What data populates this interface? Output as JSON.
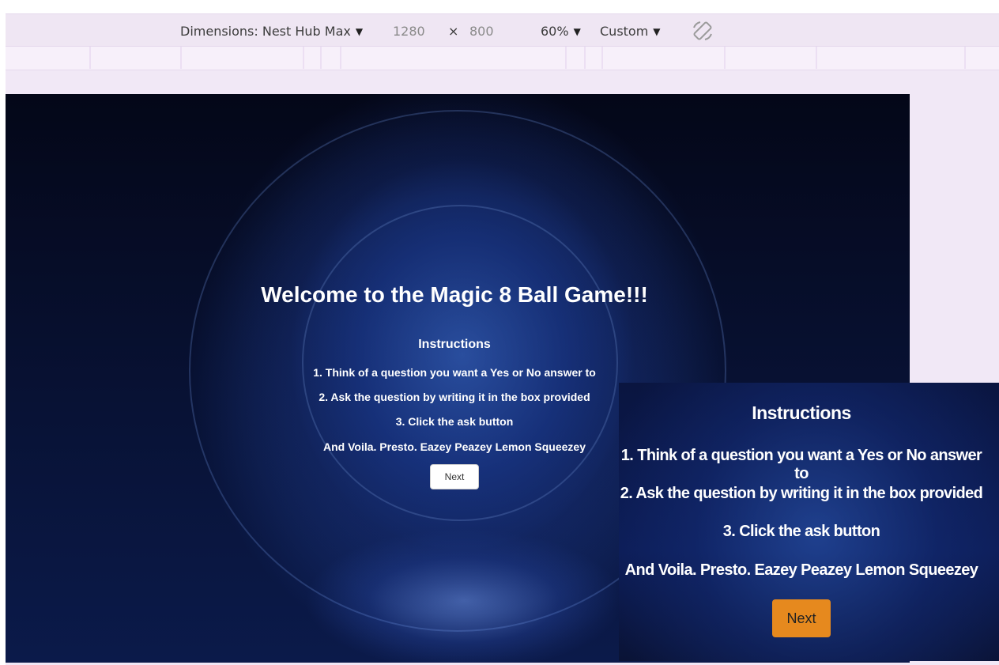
{
  "toolbar": {
    "dimensions_label": "Dimensions: Nest Hub Max",
    "width": "1280",
    "times": "×",
    "height": "800",
    "zoom": "60%",
    "throttle": "Custom",
    "caret": "▼",
    "rotate_icon": "rotate-icon"
  },
  "game": {
    "title": "Welcome to the Magic 8 Ball Game!!!",
    "instructions_heading": "Instructions",
    "steps": [
      "1. Think of a question you want a Yes or No answer to",
      "2. Ask the question by writing it in the box provided",
      "3. Click the ask button",
      "And Voila. Presto. Eazey Peazey Lemon Squeezey"
    ],
    "next_label": "Next"
  },
  "zoomed": {
    "instructions_heading": "Instructions",
    "steps": [
      "1. Think of a question you want a Yes or No answer to",
      "2. Ask the question by writing it in the box provided",
      "3. Click the ask button",
      "And Voila. Presto. Eazey Peazey Lemon Squeezey"
    ],
    "next_label": "Next",
    "next_color": "#e6891e"
  }
}
